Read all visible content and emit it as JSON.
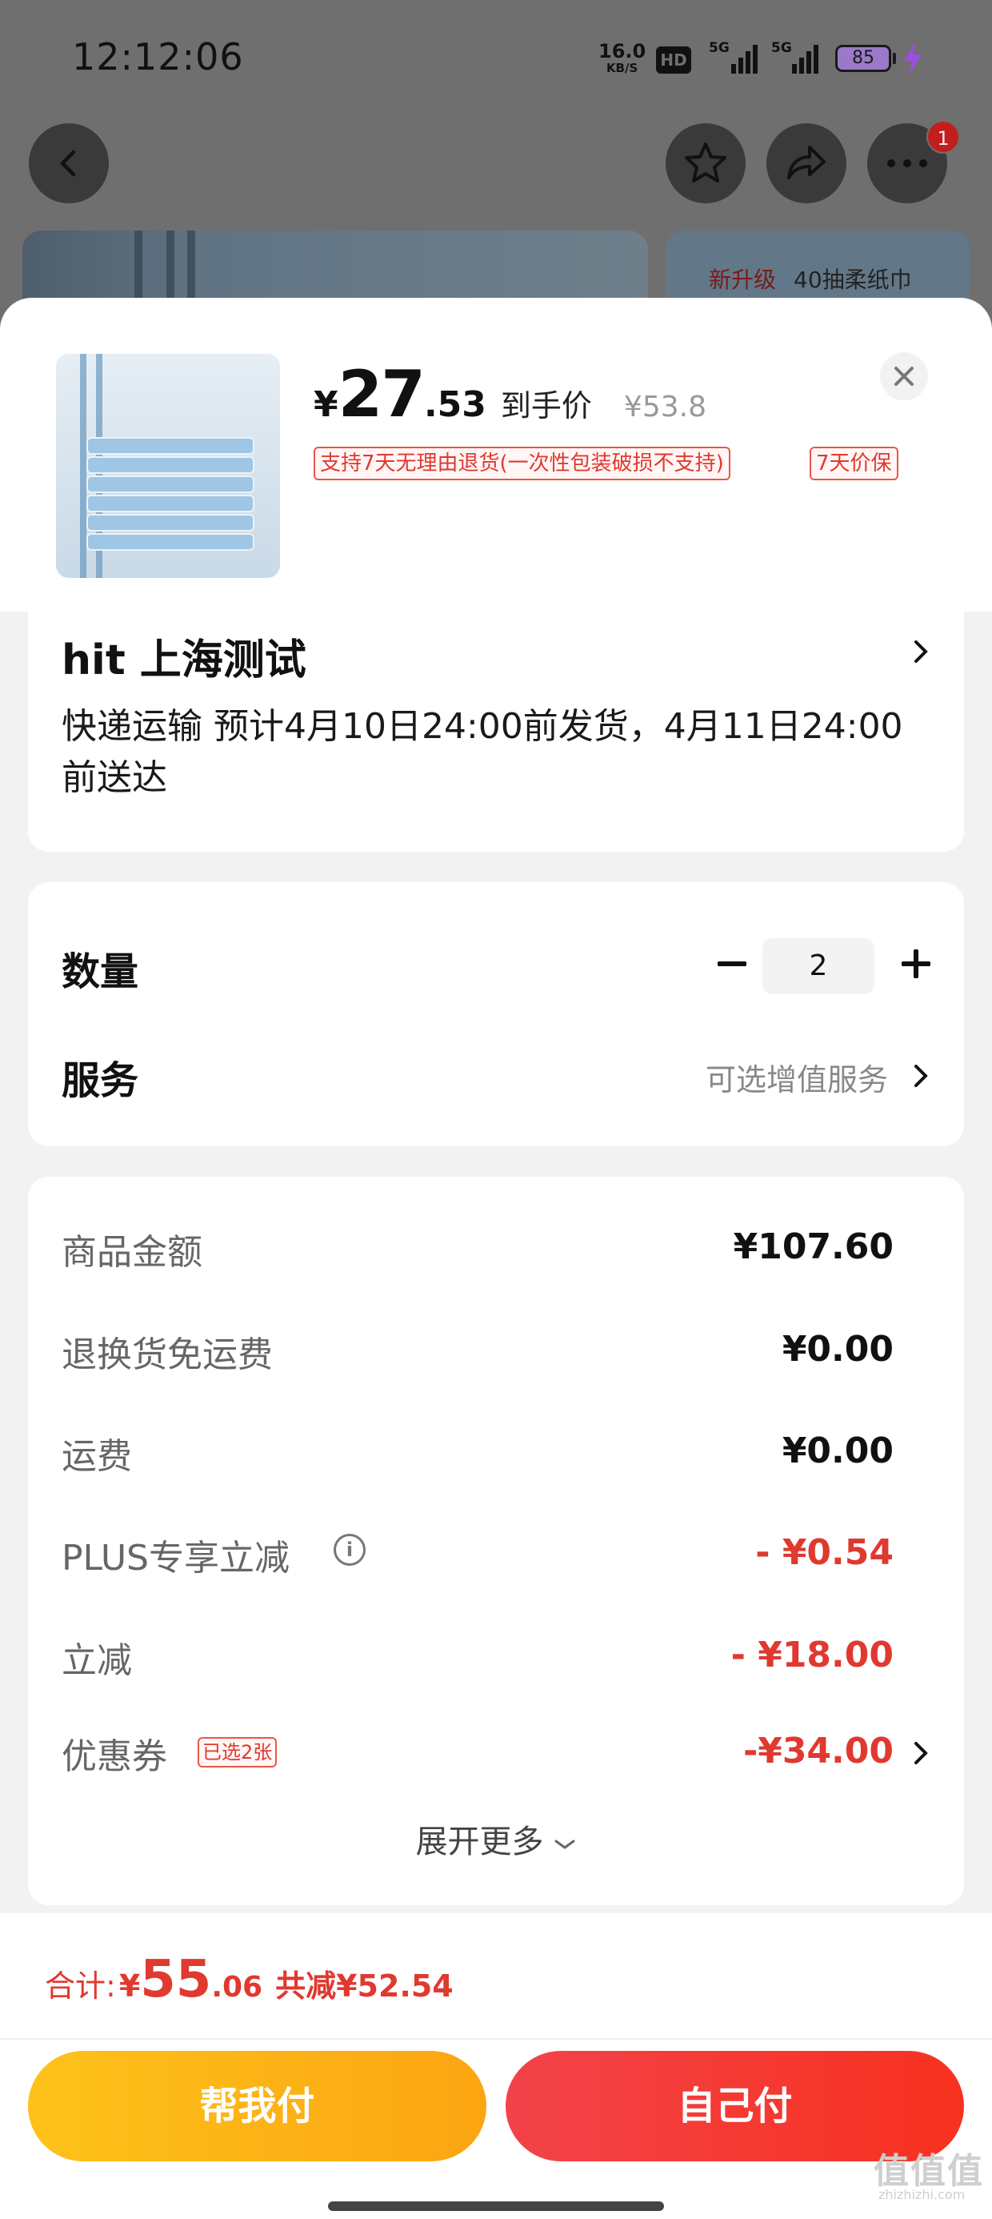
{
  "status_bar": {
    "time": "12:12:06",
    "net_speed_value": "16.0",
    "net_speed_unit": "KB/S",
    "hd_label": "HD",
    "signal1_label": "5G",
    "signal2_label": "5G",
    "battery_level": "85"
  },
  "background": {
    "notification_count": "1",
    "card_tag_new": "新升级",
    "card_text": "40抽柔纸巾"
  },
  "product": {
    "currency": "¥",
    "price_int": "27",
    "price_dec": ".53",
    "price_label": "到手价",
    "original_price": "¥53.8",
    "tag_return": "支持7天无理由退货(一次性包装破损不支持)",
    "tag_price_protect": "7天价保"
  },
  "address": {
    "name": "hit  上海测试",
    "delivery": "快递运输 预计4月10日24:00前发货，4月11日24:00前送达"
  },
  "quantity": {
    "label": "数量",
    "value": "2"
  },
  "service": {
    "label": "服务",
    "value": "可选增值服务"
  },
  "summary": {
    "rows": [
      {
        "label": "商品金额",
        "value": "¥107.60"
      },
      {
        "label": "退换货免运费",
        "value": "¥0.00"
      },
      {
        "label": "运费",
        "value": "¥0.00"
      },
      {
        "label": "PLUS专享立减",
        "value": "- ¥0.54"
      },
      {
        "label": "立减",
        "value": "- ¥18.00"
      },
      {
        "label": "优惠券",
        "value": "-¥34.00"
      }
    ],
    "coupon_tag": "已选2张",
    "info_icon": "i",
    "expand_label": "展开更多"
  },
  "footer": {
    "total_label": "合计:",
    "currency": "¥",
    "total_int": "55",
    "total_dec": ".06",
    "saved": "共减¥52.54",
    "help_pay": "帮我付",
    "self_pay": "自己付"
  },
  "watermark": {
    "text": "值值值",
    "sub": "zhizhizhi.com"
  },
  "colors": {
    "accent_red": "#e0392f",
    "help_pay_yellow": "#fdc21a",
    "self_pay_red": "#f2434a"
  }
}
